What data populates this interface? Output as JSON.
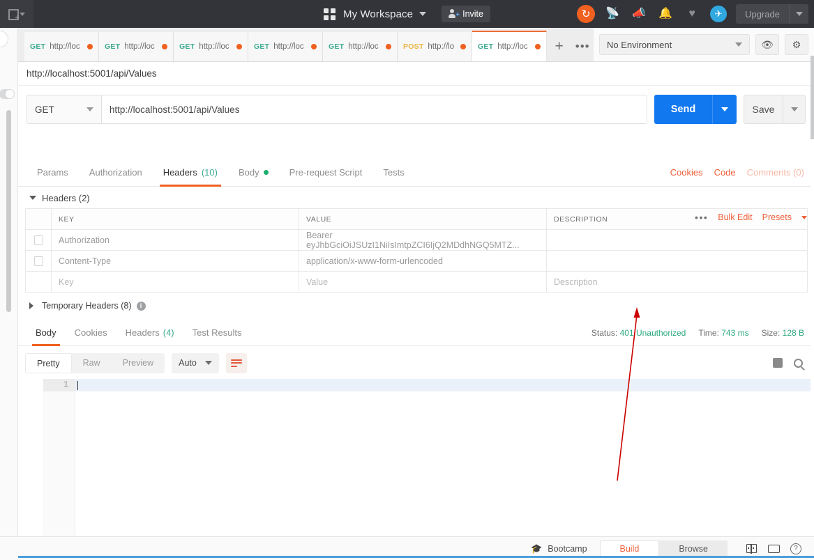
{
  "topbar": {
    "new_button_label": "New",
    "workspace_title": "My Workspace",
    "invite_label": "Invite",
    "upgrade_label": "Upgrade",
    "icons": [
      "sync-icon",
      "satellite-icon",
      "megaphone-icon",
      "bell-icon",
      "heart-icon",
      "rocket-icon"
    ]
  },
  "tabs": [
    {
      "method": "GET",
      "url": "http://loc",
      "unsaved": true,
      "active": false
    },
    {
      "method": "GET",
      "url": "http://loc",
      "unsaved": true,
      "active": false
    },
    {
      "method": "GET",
      "url": "http://loc",
      "unsaved": true,
      "active": false
    },
    {
      "method": "GET",
      "url": "http://loc",
      "unsaved": true,
      "active": false
    },
    {
      "method": "GET",
      "url": "http://loc",
      "unsaved": true,
      "active": false
    },
    {
      "method": "POST",
      "url": "http://lo",
      "unsaved": true,
      "active": false
    },
    {
      "method": "GET",
      "url": "http://loc",
      "unsaved": true,
      "active": true
    }
  ],
  "tab_actions": {
    "new_tab": "+",
    "more": "•••"
  },
  "environment": {
    "selected": "No Environment",
    "eye_icon": "eye-icon",
    "gear_icon": "gear-icon"
  },
  "request": {
    "breadcrumb_title": "http://localhost:5001/api/Values",
    "method": "GET",
    "url": "http://localhost:5001/api/Values",
    "send_label": "Send",
    "save_label": "Save"
  },
  "request_tabs": [
    {
      "label": "Params",
      "active": false
    },
    {
      "label": "Authorization",
      "active": false
    },
    {
      "label": "Headers",
      "count": "(10)",
      "active": true
    },
    {
      "label": "Body",
      "dot": true,
      "active": false
    },
    {
      "label": "Pre-request Script",
      "active": false
    },
    {
      "label": "Tests",
      "active": false
    }
  ],
  "request_tabs_right": [
    {
      "label": "Cookies",
      "dim": false
    },
    {
      "label": "Code",
      "dim": false
    },
    {
      "label": "Comments (0)",
      "dim": true
    }
  ],
  "headers_section": {
    "accordion_label": "Headers (2)",
    "bulk_edit_label": "Bulk Edit",
    "presets_label": "Presets",
    "more_label": "•••",
    "columns": [
      "KEY",
      "VALUE",
      "DESCRIPTION"
    ],
    "rows": [
      {
        "key": "Authorization",
        "value": "Bearer eyJhbGciOiJSUzI1NiIsImtpZCI6IjQ2MDdhNGQ5MTZ...",
        "description": "",
        "checked": false,
        "placeholder": false
      },
      {
        "key": "Content-Type",
        "value": "application/x-www-form-urlencoded",
        "description": "",
        "checked": false,
        "placeholder": false
      },
      {
        "key": "Key",
        "value": "Value",
        "description": "Description",
        "checked": false,
        "placeholder": true
      }
    ],
    "temporary_headers_label": "Temporary Headers (8)"
  },
  "response_tabs": [
    {
      "label": "Body",
      "active": true
    },
    {
      "label": "Cookies",
      "active": false
    },
    {
      "label": "Headers",
      "count": "(4)",
      "active": false
    },
    {
      "label": "Test Results",
      "active": false
    }
  ],
  "response_meta": {
    "status_label": "Status:",
    "status_value": "401 Unauthorized",
    "time_label": "Time:",
    "time_value": "743 ms",
    "size_label": "Size:",
    "size_value": "128 B"
  },
  "viewer": {
    "modes": [
      {
        "label": "Pretty",
        "active": true
      },
      {
        "label": "Raw",
        "active": false
      },
      {
        "label": "Preview",
        "active": false
      }
    ],
    "format": "Auto",
    "wrap_icon": "word-wrap-icon",
    "copy_icon": "copy-icon",
    "search_icon": "search-icon"
  },
  "editor": {
    "lines": [
      "1"
    ],
    "content": ""
  },
  "bottombar": {
    "bootcamp_label": "Bootcamp",
    "bootcamp_icon": "graduation-cap-icon",
    "modes": [
      {
        "label": "Build",
        "active": true
      },
      {
        "label": "Browse",
        "active": false
      }
    ],
    "icons": [
      "two-pane-layout-icon",
      "keyboard-icon",
      "help-icon"
    ]
  },
  "colors": {
    "accent_orange": "#f0601f",
    "send_blue": "#1278ef",
    "status_green": "#2aa87f",
    "method_get": "#3dab92",
    "method_post": "#ecb441",
    "annotation_red": "#cc0000"
  },
  "annotation": {
    "type": "arrow",
    "points_to": "401 Unauthorized"
  }
}
